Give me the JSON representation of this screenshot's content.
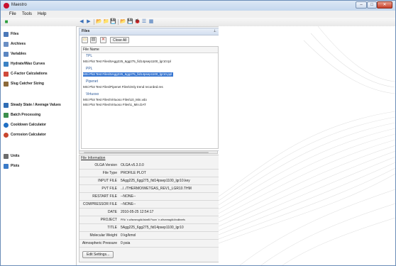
{
  "window": {
    "title": "Maestro",
    "min": "–",
    "max": "□",
    "close": "✕"
  },
  "menu": [
    "File",
    "Tools",
    "Help"
  ],
  "toolbar": [
    "◀",
    "▶",
    "📂",
    "📁",
    "💾",
    "📂",
    "💾",
    "🐞",
    "☰",
    "▦"
  ],
  "sidebar": {
    "items": [
      {
        "label": "Files",
        "icon": "files-icon",
        "color": "#4a78b8"
      },
      {
        "label": "Archives",
        "icon": "archives-icon",
        "color": "#6a8fc4"
      },
      {
        "label": "Variables",
        "icon": "variables-icon",
        "color": "#5b86c1"
      },
      {
        "label": "Hydrate/Wax Curves",
        "icon": "curve-icon",
        "color": "#3b82c4"
      },
      {
        "label": "C-Factor Calculations",
        "icon": "calc-icon",
        "color": "#d04a3b"
      },
      {
        "label": "Slug Catcher Sizing",
        "icon": "slug-icon",
        "color": "#8c6a3a"
      },
      {
        "label": "Steady State / Average Values",
        "icon": "steady-icon",
        "color": "#2f6db5"
      },
      {
        "label": "Batch Processing",
        "icon": "batch-icon",
        "color": "#3b8f4c"
      },
      {
        "label": "Cooldown Calculator",
        "icon": "cooldown-icon",
        "color": "#1f6fc4"
      },
      {
        "label": "Corrosion Calculator",
        "icon": "corrosion-icon",
        "color": "#c8462e"
      },
      {
        "label": "Units",
        "icon": "units-icon",
        "color": "#6d6d6d"
      },
      {
        "label": "Plots",
        "icon": "plots-icon",
        "color": "#3a7bc8"
      }
    ]
  },
  "files": {
    "title": "Files",
    "pin": "⊥",
    "close_all": "Close All",
    "column_header": "File Name",
    "groups": [
      {
        "name": "TPL",
        "files": [
          "MSi Plot Test Files\\5Agg225_6gg275_fid14psep1100_lgr10.tpl"
        ]
      },
      {
        "name": "PPL",
        "files": [
          "MSi Plot Test Files\\5Agg225_6gg275_fid14psep1100_lgr10.ppl"
        ]
      },
      {
        "name": "Pipenet",
        "files": [
          "MSi Plot Test Files\\Pipenet Files\\Only trend recorded.res"
        ]
      },
      {
        "name": "Virtuoso",
        "files": [
          "MSi Plot Test Files\\Virtuoso Files\\10_Min.vdo",
          "MSi Plot Test Files\\Virtuoso Files\\1_Min.DAT"
        ]
      }
    ]
  },
  "info": {
    "title": "File Information",
    "rows": [
      {
        "label": "OLGA Version",
        "value": "OLGA v5.3.0.0"
      },
      {
        "label": "File Type",
        "value": "PROFILE PLOT"
      },
      {
        "label": "INPUT FILE",
        "value": "5Agg225_6gg275_fid14psep1100_lgr10.key"
      },
      {
        "label": "PVT FILE",
        "value": "../../THERMO/WETGAS_REV1_LGR10.THM"
      },
      {
        "label": "RESTART FILE",
        "value": "--NONE--"
      },
      {
        "label": "COMPRESSOR FILE",
        "value": "--NONE--"
      },
      {
        "label": "DATE",
        "value": "2010-05-25 12:54:17"
      },
      {
        "label": "PROJECT",
        "value": "PR# `n a/fsmmsgiik:llsbe8l Fsurn `n a/fsmmsgiik:llvslibnefs"
      },
      {
        "label": "TITLE",
        "value": "5Agg225_6gg275_fid14psep1100_lgr10"
      },
      {
        "label": "Molecular Weight",
        "value": "0   kg/kmol"
      },
      {
        "label": "Atmospheric Pressure",
        "value": "0   psia"
      }
    ],
    "edit_button": "Edit Settings..."
  },
  "colors": {
    "selected": "#3877d2",
    "group_title": "#2e5b9a",
    "swirl": "#e6e6e6"
  }
}
